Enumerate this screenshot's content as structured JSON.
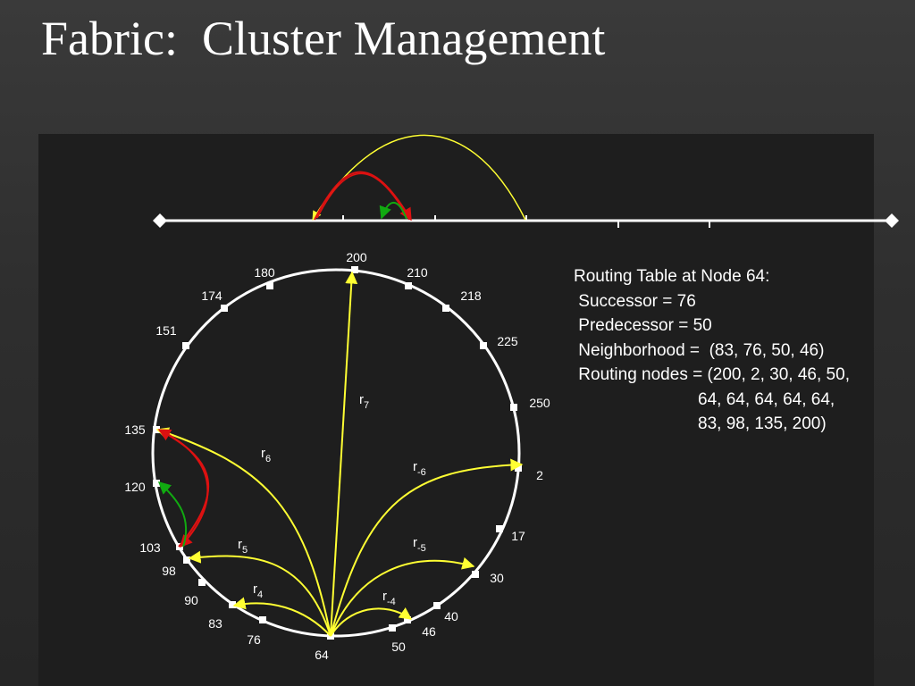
{
  "slide": {
    "title": "Fabric:  Cluster Management"
  },
  "routing_table": {
    "heading": "Routing Table at Node 64:",
    "successor": " Successor = 76",
    "predecessor": " Predecessor = 50",
    "neighborhood": " Neighborhood =  (83, 76, 50, 46)",
    "routing_nodes_1": " Routing nodes = (200, 2, 30, 46, 50,",
    "routing_nodes_2": "64, 64, 64, 64, 64,",
    "routing_nodes_3": "83, 98, 135, 200)"
  },
  "ring": {
    "nodes": [
      "200",
      "210",
      "218",
      "225",
      "250",
      "2",
      "17",
      "30",
      "40",
      "46",
      "50",
      "64",
      "76",
      "83",
      "90",
      "98",
      "103",
      "120",
      "135",
      "151",
      "174",
      "180"
    ],
    "route_labels": [
      {
        "base": "r",
        "sub": "7"
      },
      {
        "base": "r",
        "sub": "6"
      },
      {
        "base": "r",
        "sub": "-6"
      },
      {
        "base": "r",
        "sub": "5"
      },
      {
        "base": "r",
        "sub": "-5"
      },
      {
        "base": "r",
        "sub": "4"
      },
      {
        "base": "r",
        "sub": "-4"
      }
    ]
  },
  "colors": {
    "route": "#ffff33",
    "red_arrow": "#dd1111",
    "green_arrow": "#11aa11",
    "line": "#ffffff"
  }
}
